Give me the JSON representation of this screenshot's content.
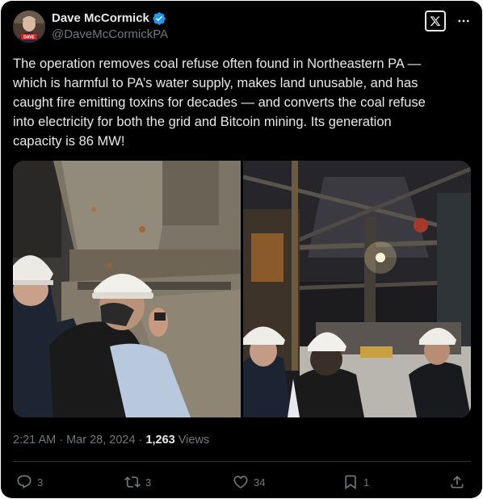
{
  "author": {
    "name": "Dave McCormick",
    "handle": "@DaveMcCormickPA",
    "avatar_badge": "DAVE",
    "verified": true
  },
  "tweet": {
    "lines": [
      "The operation removes coal refuse often found in Northeastern PA —",
      "which is harmful to PA’s water supply, makes land unusable, and has",
      "caught fire emitting toxins for decades — and converts the coal refuse",
      "into electricity for both the grid and Bitcoin mining. Its generation",
      "capacity is 86 MW!"
    ]
  },
  "media": {
    "images": [
      "photo-inspection-closeup",
      "photo-plant-interior"
    ]
  },
  "meta": {
    "time": "2:21 AM",
    "sep1": " · ",
    "date": "Mar 28, 2024",
    "sep2": " · ",
    "views_count": "1,263",
    "views_label": " Views"
  },
  "actions": {
    "replies": "3",
    "reposts": "3",
    "likes": "34",
    "bookmarks": "1"
  },
  "colors": {
    "background": "#000000",
    "text": "#e7e9ea",
    "secondary": "#71767b",
    "verified": "#1d9bf0",
    "divider": "#2f3336"
  },
  "icons": [
    "verified-badge-icon",
    "x-logo-icon",
    "more-icon",
    "reply-icon",
    "repost-icon",
    "like-icon",
    "bookmark-icon",
    "share-icon"
  ]
}
